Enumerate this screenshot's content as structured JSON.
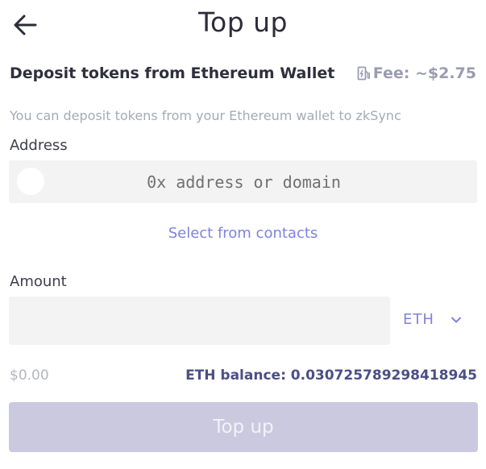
{
  "header": {
    "title": "Top up",
    "back_icon": "arrow-left-icon"
  },
  "deposit": {
    "title": "Deposit tokens from Ethereum Wallet",
    "fee_label": "Fee: ~$2.75",
    "fee_icon": "gas-pump-icon",
    "description": "You can deposit tokens from your Ethereum wallet to zkSync"
  },
  "address": {
    "label": "Address",
    "placeholder": "0x address or domain",
    "value": "",
    "contacts_link": "Select from contacts"
  },
  "amount": {
    "label": "Amount",
    "value": "",
    "token": "ETH",
    "token_icon": "chevron-down-icon",
    "usd_value": "$0.00",
    "balance": "ETH balance: 0.030725789298418945"
  },
  "actions": {
    "submit_label": "Top up"
  },
  "colors": {
    "accent": "#7f82e0",
    "balance_text": "#4b4f86",
    "button_disabled": "#cac9e0",
    "input_background": "#f3f3f3",
    "muted_text": "#a7a9b6"
  }
}
